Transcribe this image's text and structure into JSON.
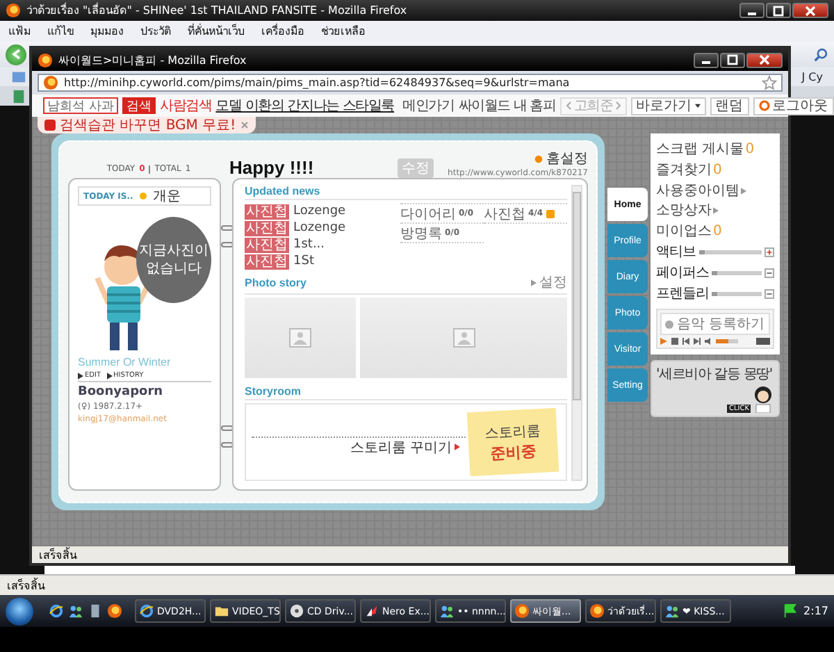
{
  "outer_window": {
    "title": "ว่าด้วยเรื่อง \"เลื่อนอัด\" - SHINee' 1st THAILAND FANSITE - Mozilla Firefox",
    "menu": [
      "แฟ้ม",
      "แก้ไข",
      "มุมมอง",
      "ประวัติ",
      "ที่คั่นหน้าเว็บ",
      "เครื่องมือ",
      "ช่วยเหลือ"
    ],
    "bookmark_text": "J Cy",
    "status": "เสร็จสิ้น"
  },
  "popup_window": {
    "title": "싸이월드>미니홈피 - Mozilla Firefox",
    "url": "http://minihp.cyworld.com/pims/main/pims_main.asp?tid=62484937&seq=9&urlstr=mana",
    "search": {
      "value": "남희석 사과",
      "button": "검색"
    },
    "people_search": "사람검색",
    "promo_link": "모델 이환의 간지나는 스타일룩",
    "nav_links": [
      {
        "label": "메인가기",
        "kind": "link"
      },
      {
        "label": "싸이월드 내 홈피",
        "kind": "link"
      },
      {
        "label": "고희준",
        "kind": "stepper"
      },
      {
        "label": "바로가기",
        "kind": "dropdown"
      },
      {
        "label": "랜덤",
        "kind": "button"
      },
      {
        "label": "로그아웃",
        "kind": "logout"
      }
    ],
    "notice": "검색습관 바꾸면 BGM 무료!",
    "status": "เสร็จสิ้น"
  },
  "minihompy": {
    "counter": {
      "today_label": "TODAY",
      "today": "0",
      "total_label": "TOTAL",
      "total": "1"
    },
    "mood": {
      "label": "TODAY IS..",
      "value": "개운"
    },
    "speech_bubble": "지금사진이 없습니다",
    "profile_title": "Summer Or Winter",
    "edit_links": [
      "EDIT",
      "HISTORY"
    ],
    "owner": {
      "name": "Boonyaporn",
      "birth": "(♀) 1987.2.17+",
      "email": "kingj17@hanmail.net"
    },
    "title": "Happy !!!!",
    "edit_button": "수정",
    "home_setting": "홈설정",
    "home_url": "http://www.cyworld.com/k870217",
    "updated_news": {
      "heading": "Updated news",
      "items": [
        {
          "tag": "사진첩",
          "text": "Lozenge"
        },
        {
          "tag": "사진첩",
          "text": "Lozenge"
        },
        {
          "tag": "사진첩",
          "text": "1st..."
        },
        {
          "tag": "사진첩",
          "text": "1St"
        }
      ],
      "counts": [
        {
          "label": "다이어리",
          "value": "0/0",
          "new": false
        },
        {
          "label": "사진첩",
          "value": "4/4",
          "new": true
        },
        {
          "label": "방명록",
          "value": "0/0",
          "new": false
        }
      ]
    },
    "photo_story": {
      "heading": "Photo story",
      "setting": "설정",
      "photos": [
        {
          "kind": "placeholder"
        },
        {
          "kind": "placeholder"
        }
      ]
    },
    "storyroom": {
      "heading": "Storyroom",
      "decorate_link": "스토리룸 꾸미기",
      "note_title": "스토리룸",
      "note_status": "준비중"
    },
    "tabs": [
      {
        "label": "Home",
        "selected": true
      },
      {
        "label": "Profile",
        "selected": false
      },
      {
        "label": "Diary",
        "selected": false
      },
      {
        "label": "Photo",
        "selected": false
      },
      {
        "label": "Visitor",
        "selected": false
      },
      {
        "label": "Setting",
        "selected": false
      }
    ],
    "side_panel": {
      "rows": [
        {
          "items": [
            {
              "label": "스크랩 게시물",
              "count": "0"
            }
          ]
        },
        {
          "items": [
            {
              "label": "즐겨찾기",
              "count": "0"
            }
          ]
        },
        {
          "items": [
            {
              "label": "사용중아이템"
            },
            {
              "label": "소망상자"
            }
          ]
        },
        {
          "items": [
            {
              "label": "미이업스",
              "count": "0"
            }
          ]
        }
      ],
      "gauges": [
        {
          "label": "액티브",
          "kind": "plus"
        },
        {
          "label": "페이퍼스",
          "kind": "minus"
        },
        {
          "label": "프렌들리",
          "kind": "minus"
        }
      ],
      "music": {
        "label": "음악 등록하기",
        "volume": {
          "level": 0.55
        }
      },
      "banner": {
        "text": "'세르비아 갈등 몽땅'",
        "click": "CLICK"
      }
    }
  },
  "taskbar": {
    "tasks": [
      {
        "label": "DVD2H...",
        "kind": "ie",
        "selected": false
      },
      {
        "label": "VIDEO_TS",
        "kind": "folder",
        "selected": false
      },
      {
        "label": "CD Driv...",
        "kind": "cd",
        "selected": false
      },
      {
        "label": "Nero Ex...",
        "kind": "nero",
        "selected": false
      },
      {
        "label": "•• nnnn...",
        "kind": "messenger",
        "selected": false
      },
      {
        "label": "싸이월...",
        "kind": "browser",
        "selected": true
      },
      {
        "label": "ว่าด้วยเรื่...",
        "kind": "browser",
        "selected": false
      },
      {
        "label": "❤ KISS...",
        "kind": "messenger",
        "selected": false
      }
    ],
    "clock": "2:17"
  }
}
